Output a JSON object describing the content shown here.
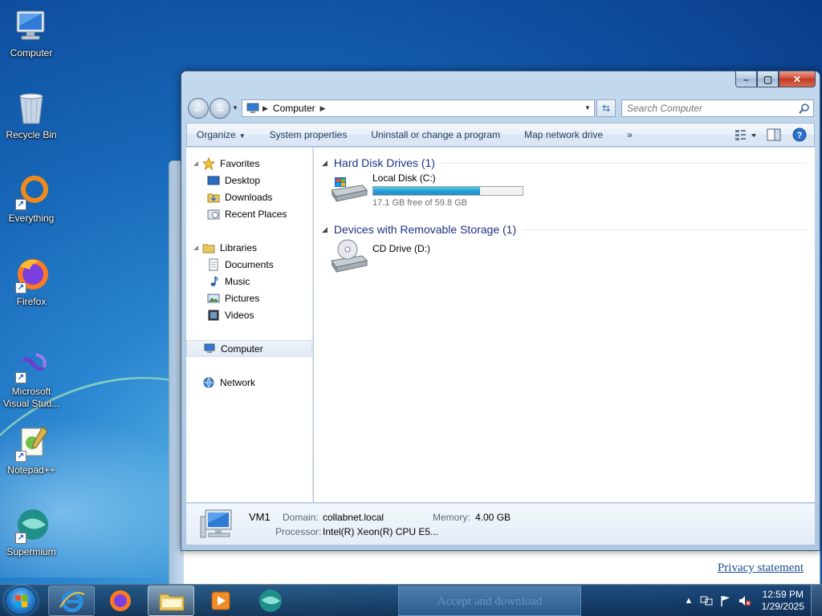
{
  "desktop": {
    "icons": [
      {
        "label": "Computer"
      },
      {
        "label": "Recycle Bin"
      },
      {
        "label": "Everything"
      },
      {
        "label": "Firefox"
      },
      {
        "label": "Microsoft Visual Stud..."
      },
      {
        "label": "Notepad++"
      },
      {
        "label": "Supermium"
      }
    ]
  },
  "background_window": {
    "link": "Privacy statement"
  },
  "explorer": {
    "caption": {
      "minimize": "–",
      "maximize": "▢",
      "close": "✕"
    },
    "address": {
      "crumb": "Computer"
    },
    "search": {
      "placeholder": "Search Computer"
    },
    "commands": {
      "organize": "Organize",
      "system_properties": "System properties",
      "uninstall": "Uninstall or change a program",
      "map_drive": "Map network drive",
      "more": "»"
    },
    "nav": {
      "favorites": "Favorites",
      "desktop": "Desktop",
      "downloads": "Downloads",
      "recent": "Recent Places",
      "libraries": "Libraries",
      "documents": "Documents",
      "music": "Music",
      "pictures": "Pictures",
      "videos": "Videos",
      "computer": "Computer",
      "network": "Network"
    },
    "groups": {
      "hdd": "Hard Disk Drives (1)",
      "removable": "Devices with Removable Storage (1)"
    },
    "drives": {
      "c": {
        "name": "Local Disk (C:)",
        "free": "17.1 GB free of 59.8 GB",
        "used_fraction": 0.714
      },
      "d": {
        "name": "CD Drive (D:)"
      }
    },
    "details": {
      "name": "VM1",
      "domain_label": "Domain:",
      "domain_value": "collabnet.local",
      "memory_label": "Memory:",
      "memory_value": "4.00 GB",
      "processor_label": "Processor:",
      "processor_value": "Intel(R) Xeon(R) CPU E5..."
    }
  },
  "taskbar": {
    "popup_text": "Accept and download",
    "clock_time": "12:59 PM",
    "clock_date": "1/29/2025"
  },
  "colors": {
    "accent": "#1e3287",
    "progress": "#26a0da",
    "link": "#1c4e8f"
  }
}
